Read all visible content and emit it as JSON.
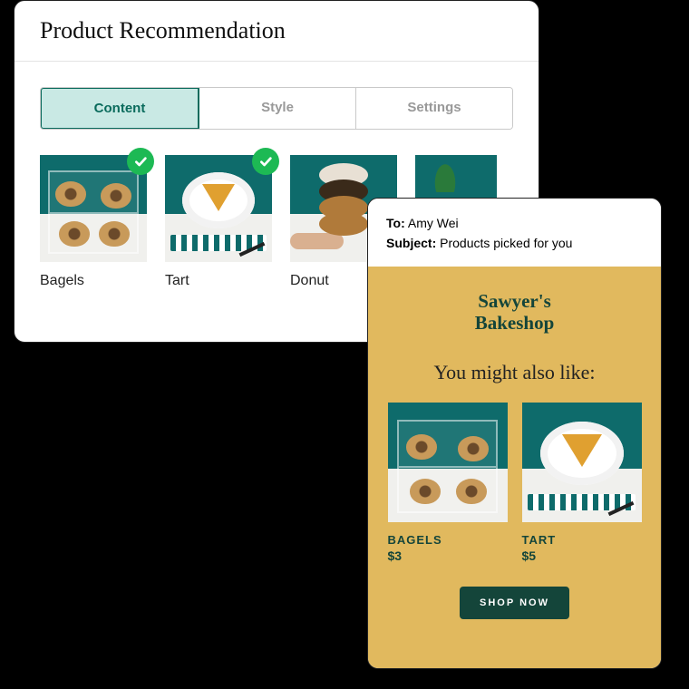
{
  "admin": {
    "title": "Product Recommendation",
    "tabs": [
      {
        "label": "Content",
        "active": true
      },
      {
        "label": "Style",
        "active": false
      },
      {
        "label": "Settings",
        "active": false
      }
    ],
    "products": [
      {
        "label": "Bagels",
        "selected": true
      },
      {
        "label": "Tart",
        "selected": true
      },
      {
        "label": "Donut",
        "selected": false
      },
      {
        "label": "",
        "selected": false
      }
    ]
  },
  "email": {
    "to_label": "To:",
    "to_value": "Amy Wei",
    "subject_label": "Subject:",
    "subject_value": "Products picked for you",
    "brand_line1": "Sawyer's",
    "brand_line2": "Bakeshop",
    "recommend_title": "You might also like:",
    "products": [
      {
        "name": "BAGELS",
        "price": "$3"
      },
      {
        "name": "TART",
        "price": "$5"
      }
    ],
    "cta": "SHOP NOW"
  },
  "colors": {
    "teal": "#0e6b6b",
    "accent_green": "#1db954",
    "mustard": "#e1b95e",
    "dark_green": "#14453a",
    "tab_active_bg": "#c9e9e4"
  }
}
